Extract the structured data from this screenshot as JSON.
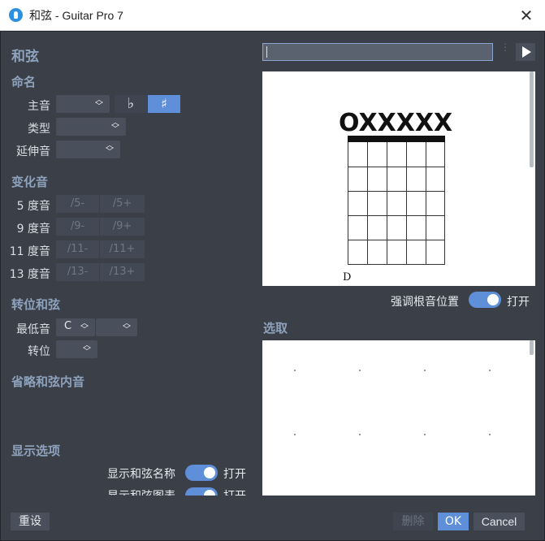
{
  "window": {
    "title": "和弦 - Guitar Pro 7",
    "close_glyph": "✕"
  },
  "panel_title": "和弦",
  "naming": {
    "heading": "命名",
    "root_label": "主音",
    "flat": "♭",
    "sharp": "♯",
    "type_label": "类型",
    "extension_label": "延伸音"
  },
  "alterations": {
    "heading": "变化音",
    "rows": [
      {
        "label": "5 度音",
        "minus": "/5-",
        "plus": "/5+"
      },
      {
        "label": "9 度音",
        "minus": "/9-",
        "plus": "/9+"
      },
      {
        "label": "11 度音",
        "minus": "/11-",
        "plus": "/11+"
      },
      {
        "label": "13 度音",
        "minus": "/13-",
        "plus": "/13+"
      }
    ]
  },
  "inversion": {
    "heading": "转位和弦",
    "bass_label": "最低音",
    "bass_value": "C",
    "inversion_label": "转位"
  },
  "omit_heading": "省略和弦内音",
  "display": {
    "heading": "显示选项",
    "show_name_label": "显示和弦名称",
    "show_name_state": "打开",
    "show_diagram_label": "显示和弦图表",
    "show_diagram_state": "打开"
  },
  "diagram": {
    "string_marks": [
      "O",
      "X",
      "X",
      "X",
      "X",
      "X"
    ],
    "fret_label": "D",
    "emphasize_root_label": "强调根音位置",
    "emphasize_root_state": "打开"
  },
  "selection_heading": "选取",
  "footer": {
    "reset": "重设",
    "delete": "删除",
    "ok": "OK",
    "cancel": "Cancel"
  },
  "colors": {
    "panel_bg": "#3a3f48",
    "heading": "#8fa2bc",
    "accent": "#5e8fd8",
    "field_bg": "#4a505b"
  }
}
